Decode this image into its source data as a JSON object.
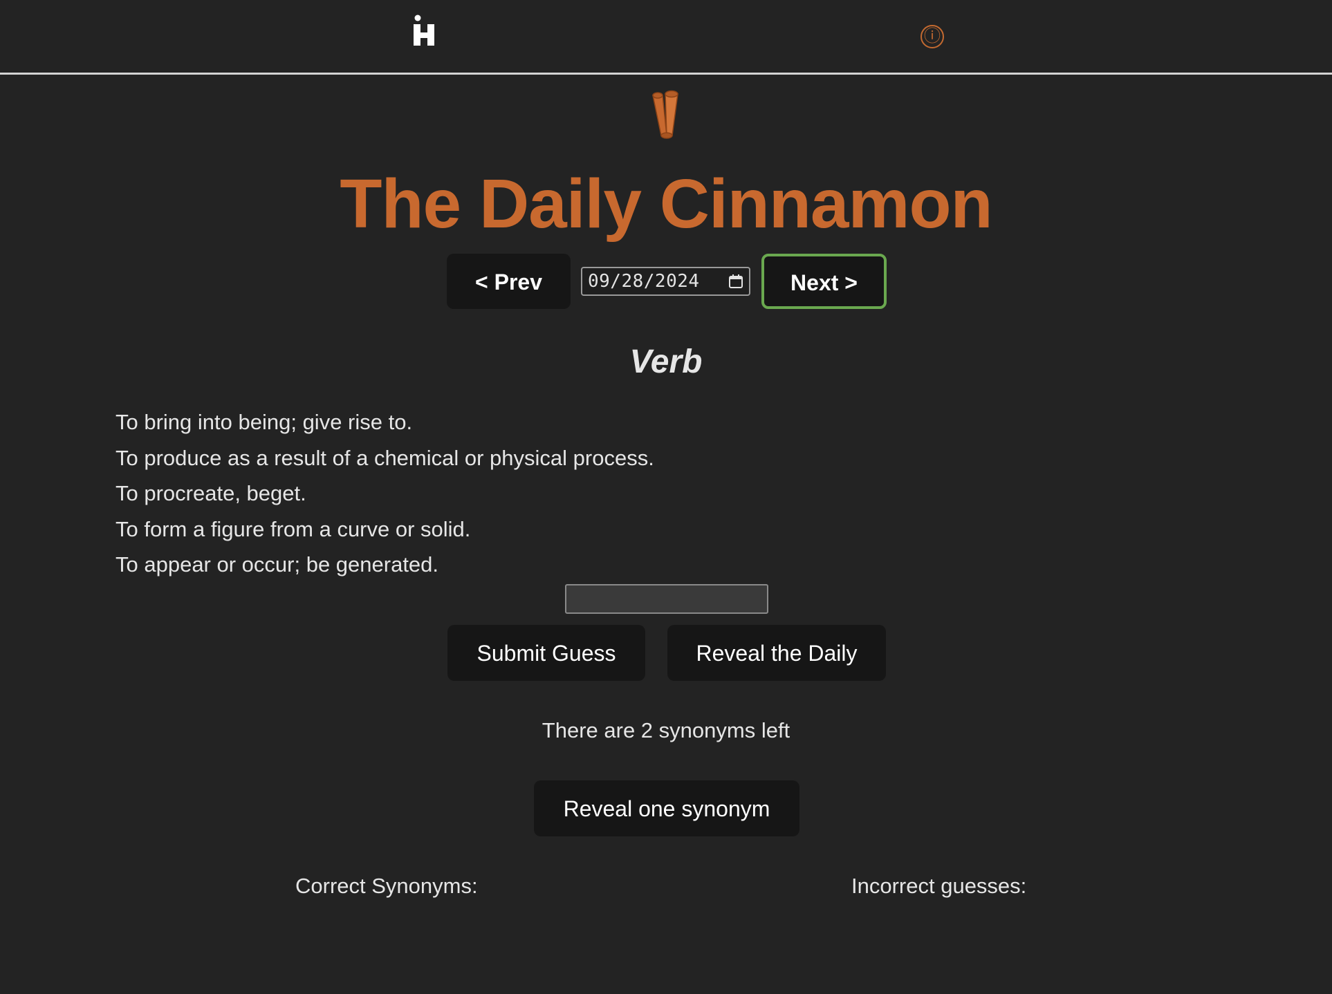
{
  "header": {
    "logo_icon": "letter-h-logo-icon",
    "info_symbol": "ⓘ",
    "info_icon": "info-circle-icon",
    "accent_color": "#c8692f"
  },
  "hero": {
    "icon": "cinnamon-stick-icon",
    "title": "The Daily Cinnamon"
  },
  "date_nav": {
    "prev_label": "< Prev",
    "date_value": "09/28/2024",
    "next_label": "Next >",
    "next_border_color": "#6aa84f"
  },
  "word": {
    "part_of_speech": "Verb",
    "definitions": [
      "To bring into being; give rise to.",
      "To produce as a result of a chemical or physical process.",
      "To procreate, beget.",
      "To form a figure from a curve or solid.",
      "To appear or occur; be generated."
    ]
  },
  "guess": {
    "input_value": "",
    "submit_label": "Submit Guess",
    "reveal_daily_label": "Reveal the Daily"
  },
  "status": {
    "message": "There are 2 synonyms left",
    "reveal_one_label": "Reveal one synonym"
  },
  "results": {
    "correct_label": "Correct Synonyms:",
    "incorrect_label": "Incorrect guesses:"
  }
}
